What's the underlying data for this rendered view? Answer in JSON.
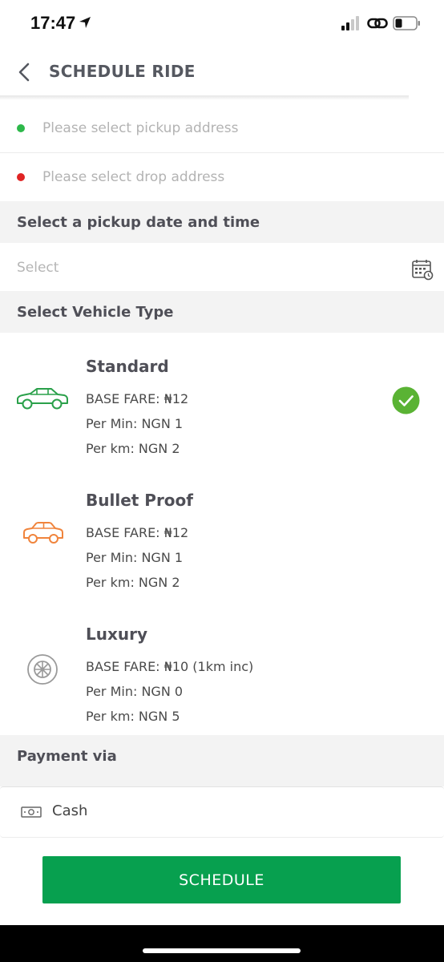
{
  "status_bar": {
    "time": "17:47"
  },
  "header": {
    "title": "SCHEDULE RIDE"
  },
  "addresses": {
    "pickup_placeholder": "Please select pickup address",
    "drop_placeholder": "Please select drop address",
    "pickup_dot_color": "#2db84a",
    "drop_dot_color": "#e02424"
  },
  "pickup_time": {
    "section_title": "Select a pickup date and time",
    "placeholder": "Select"
  },
  "vehicle_section": {
    "title": "Select Vehicle Type",
    "vehicles": [
      {
        "name": "Standard",
        "base_fare": "BASE FARE: ₦12",
        "per_min": "Per Min: NGN 1",
        "per_km": "Per km: NGN 2",
        "icon": "sedan-car-icon",
        "icon_color": "#2aa04a",
        "selected": true
      },
      {
        "name": "Bullet Proof",
        "base_fare": "BASE FARE: ₦12",
        "per_min": "Per Min: NGN 1",
        "per_km": "Per km: NGN 2",
        "icon": "car-icon",
        "icon_color": "#f0843c",
        "selected": false
      },
      {
        "name": "Luxury",
        "base_fare": "BASE FARE: ₦10 (1km inc)",
        "per_min": "Per Min: NGN 0",
        "per_km": "Per km: NGN 5",
        "icon": "wheel-icon",
        "icon_color": "#9a9a9a",
        "selected": false
      }
    ]
  },
  "payment": {
    "section_title": "Payment via",
    "method": "Cash"
  },
  "actions": {
    "schedule_label": "SCHEDULE"
  },
  "colors": {
    "accent": "#07a04f",
    "selected_check": "#5ab334"
  }
}
